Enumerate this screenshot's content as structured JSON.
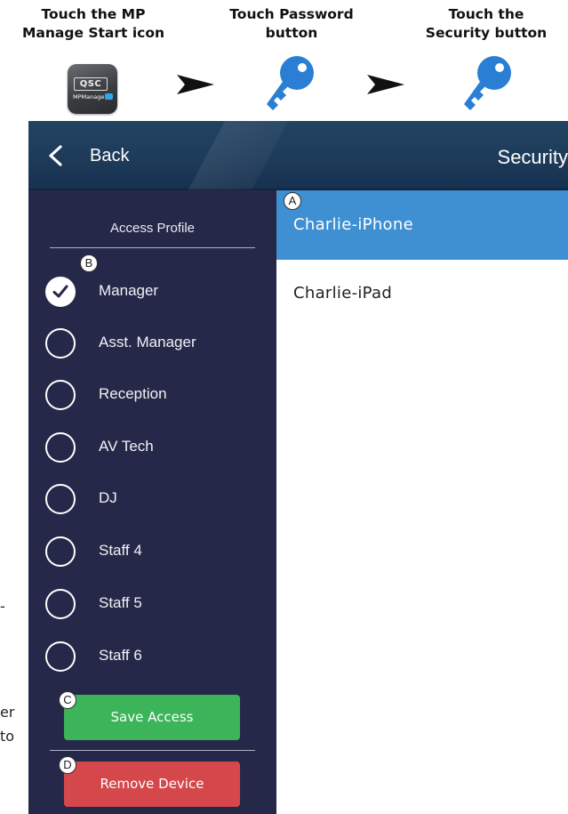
{
  "instructions": {
    "steps": [
      {
        "line1": "Touch the MP",
        "line2": "Manage Start icon"
      },
      {
        "line1": "Touch Password",
        "line2": "button"
      },
      {
        "line1": "Touch the",
        "line2": "Security button"
      }
    ],
    "app_icon": {
      "brand": "QSC",
      "caption": "MPManage"
    }
  },
  "header": {
    "back_label": "Back",
    "title": "Security"
  },
  "sidebar": {
    "title": "Access Profile",
    "profiles": [
      {
        "label": "Manager",
        "checked": true
      },
      {
        "label": "Asst. Manager",
        "checked": false
      },
      {
        "label": "Reception",
        "checked": false
      },
      {
        "label": "AV Tech",
        "checked": false
      },
      {
        "label": "DJ",
        "checked": false
      },
      {
        "label": "Staff 4",
        "checked": false
      },
      {
        "label": "Staff 5",
        "checked": false
      },
      {
        "label": "Staff 6",
        "checked": false
      }
    ],
    "save_label": "Save Access",
    "remove_label": "Remove Device"
  },
  "devices": [
    {
      "name": "Charlie-iPhone",
      "selected": true
    },
    {
      "name": "Charlie-iPad",
      "selected": false
    }
  ],
  "callouts": {
    "a": "A",
    "b": "B",
    "c": "C",
    "d": "D"
  },
  "cropped_text": {
    "frag1": "-",
    "frag2": "er",
    "frag3": "to"
  },
  "colors": {
    "header": "#1d3a58",
    "sidebar": "#262849",
    "selected_row": "#3f8fd3",
    "save": "#3bb45a",
    "remove": "#d4484b"
  }
}
